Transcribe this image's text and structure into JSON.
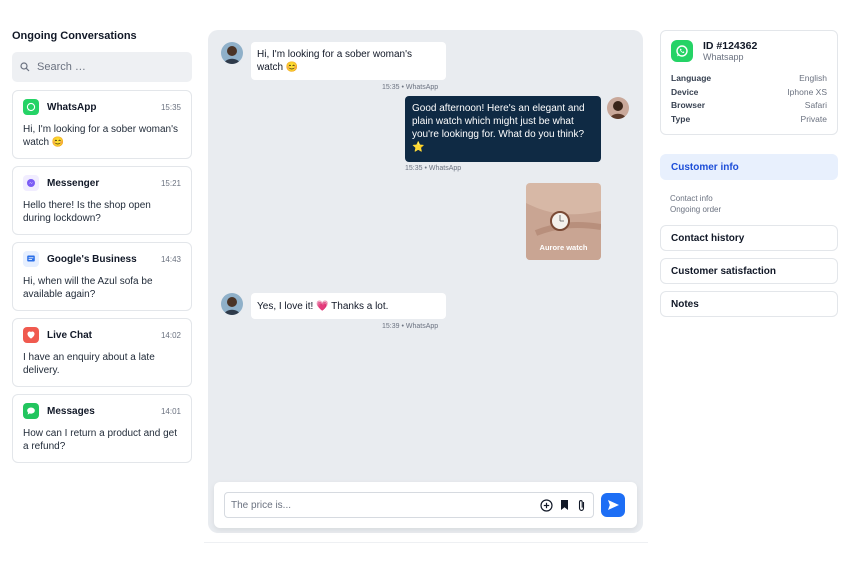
{
  "sidebar": {
    "title": "Ongoing Conversations",
    "search_placeholder": "Search …",
    "conversations": [
      {
        "channel": "WhatsApp",
        "time": "15:35",
        "text": "Hi, I'm looking for a sober woman's watch 😊",
        "icon": "whatsapp-icon",
        "color": "#25d366"
      },
      {
        "channel": "Messenger",
        "time": "15:21",
        "text": "Hello there! Is the shop open during lockdown?",
        "icon": "messenger-icon",
        "color": "#7b5cf5"
      },
      {
        "channel": "Google's Business",
        "time": "14:43",
        "text": "Hi, when will the Azul sofa be available again?",
        "icon": "google-business-icon",
        "color": "#2b6fe8"
      },
      {
        "channel": "Live Chat",
        "time": "14:02",
        "text": "I have an enquiry about a late delivery.",
        "icon": "live-chat-icon",
        "color": "#f05a4f"
      },
      {
        "channel": "Messages",
        "time": "14:01",
        "text": "How can I return a product and get a refund?",
        "icon": "messages-icon",
        "color": "#22c55e"
      }
    ]
  },
  "chat": {
    "messages": [
      {
        "text": "Hi, I'm looking for a sober woman's watch 😊",
        "meta": "15:35 • WhatsApp"
      },
      {
        "text": "Good afternoon! Here's an elegant and plain watch which might just be what you're lookingg for. What do you think? ⭐",
        "meta": "15:35 • WhatsApp"
      },
      {
        "text": "Yes, I love it! 💗 Thanks a lot.",
        "meta": "15:39 • WhatsApp"
      }
    ],
    "image_caption": "Aurore watch",
    "composer_placeholder": "The price is..."
  },
  "customer": {
    "id": "ID #124362",
    "channel": "Whatsapp",
    "fields": [
      {
        "label": "Language",
        "value": "English"
      },
      {
        "label": "Device",
        "value": "Iphone XS"
      },
      {
        "label": "Browser",
        "value": "Safari"
      },
      {
        "label": "Type",
        "value": "Private"
      }
    ]
  },
  "panels": {
    "customer_info": "Customer info",
    "customer_info_lines": [
      "Contact info",
      "Ongoing order"
    ],
    "contact_history": "Contact history",
    "customer_satisfaction": "Customer satisfaction",
    "notes": "Notes"
  },
  "colors": {
    "accent": "#1d6ef5",
    "dark_bubble": "#0f2a44",
    "chat_bg": "#e9ecf0"
  }
}
